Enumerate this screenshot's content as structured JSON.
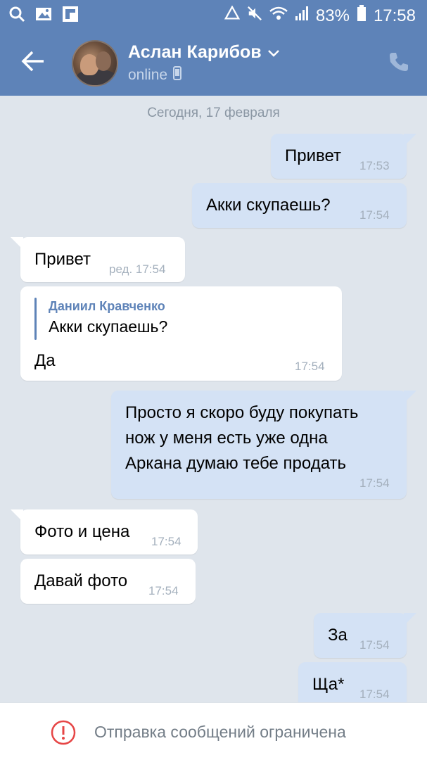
{
  "status_bar": {
    "left_icons": [
      "search-icon",
      "image-icon",
      "flipboard-icon"
    ],
    "battery": "83%",
    "time": "17:58"
  },
  "header": {
    "contact_name": "Аслан Карибов",
    "presence": "online"
  },
  "chat": {
    "date_divider": "Сегодня, 17 февраля",
    "messages": [
      {
        "dir": "out",
        "text": "Привет",
        "time": "17:53"
      },
      {
        "dir": "out",
        "text": "Акки скупаешь?",
        "time": "17:54"
      },
      {
        "dir": "in",
        "text": "Привет",
        "time": "ред. 17:54"
      },
      {
        "dir": "in",
        "reply_author": "Даниил Кравченко",
        "reply_text": "Акки скупаешь?",
        "text": "Да",
        "time": "17:54"
      },
      {
        "dir": "out",
        "lines": [
          "Просто я скоро буду покупать",
          "нож у меня есть уже одна",
          "Аркана думаю тебе продать"
        ],
        "time": "17:54"
      },
      {
        "dir": "in",
        "text": "Фото и цена",
        "time": "17:54"
      },
      {
        "dir": "in",
        "text": "Давай фото",
        "time": "17:54"
      },
      {
        "dir": "out",
        "text": "За",
        "time": "17:54"
      },
      {
        "dir": "out",
        "text": "Ща*",
        "time": "17:54"
      }
    ]
  },
  "footer": {
    "restriction_text": "Отправка сообщений ограничена"
  },
  "colors": {
    "header": "#5e83b8",
    "background": "#dfe5ec",
    "outgoing": "#d4e2f5",
    "incoming": "#ffffff",
    "warning": "#e64646"
  }
}
